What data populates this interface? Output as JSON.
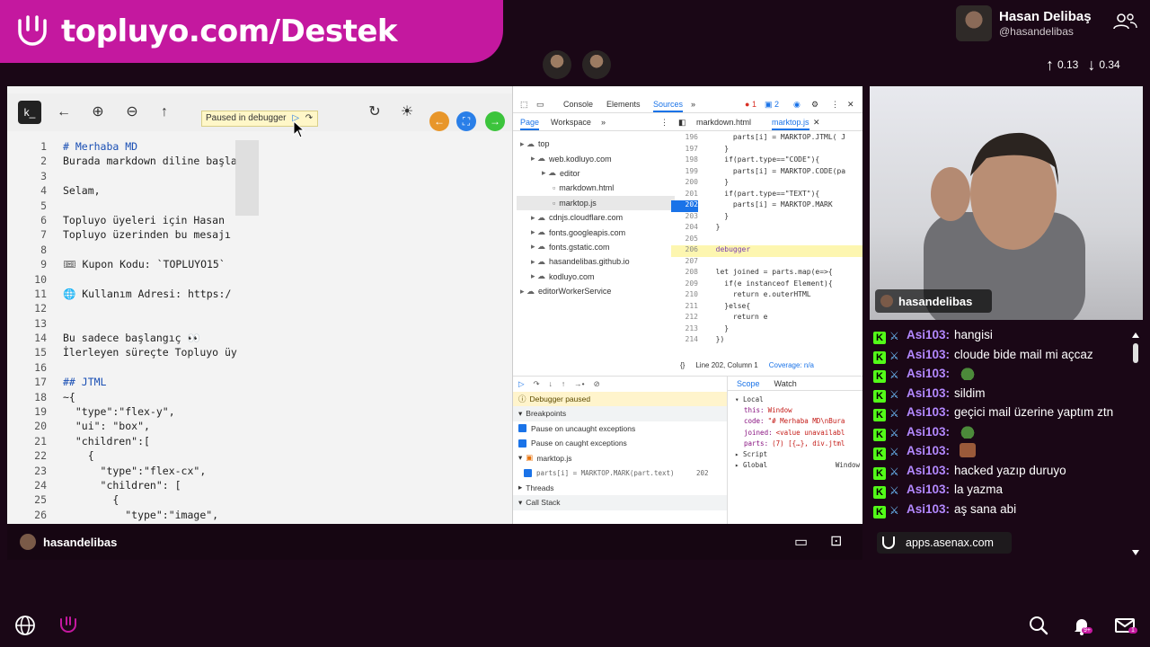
{
  "banner": {
    "text": "topluyo.com/Destek"
  },
  "streamer": {
    "name": "Hasan Delibaş",
    "handle": "@hasandelibas"
  },
  "votes": {
    "up": "0.13",
    "down": "0.34"
  },
  "browser": {
    "paused_label": "Paused in debugger"
  },
  "editor": {
    "lines": [
      {
        "n": "1",
        "t": "# Merhaba MD"
      },
      {
        "n": "2",
        "t": "Burada markdown diline başla"
      },
      {
        "n": "3",
        "t": ""
      },
      {
        "n": "4",
        "t": "Selam,"
      },
      {
        "n": "5",
        "t": ""
      },
      {
        "n": "6",
        "t": "Topluyo üyeleri için Hasan"
      },
      {
        "n": "7",
        "t": "Topluyo üzerinden bu mesajı"
      },
      {
        "n": "8",
        "t": ""
      },
      {
        "n": "9",
        "t": "🎟 Kupon Kodu: `TOPLUYO15`"
      },
      {
        "n": "10",
        "t": ""
      },
      {
        "n": "11",
        "t": "🌐 Kullanım Adresi: https:/"
      },
      {
        "n": "12",
        "t": ""
      },
      {
        "n": "13",
        "t": ""
      },
      {
        "n": "14",
        "t": "Bu sadece başlangıç 👀"
      },
      {
        "n": "15",
        "t": "İlerleyen süreçte Topluyo üy"
      },
      {
        "n": "16",
        "t": ""
      },
      {
        "n": "17",
        "t": "## JTML"
      },
      {
        "n": "18",
        "t": "~{"
      },
      {
        "n": "19",
        "t": "  \"type\":\"flex-y\","
      },
      {
        "n": "20",
        "t": "  \"ui\": \"box\","
      },
      {
        "n": "21",
        "t": "  \"children\":["
      },
      {
        "n": "22",
        "t": "    {"
      },
      {
        "n": "23",
        "t": "      \"type\":\"flex-cx\","
      },
      {
        "n": "24",
        "t": "      \"children\": ["
      },
      {
        "n": "25",
        "t": "        {"
      },
      {
        "n": "26",
        "t": "          \"type\":\"image\","
      }
    ]
  },
  "devtools": {
    "tabs": [
      "Console",
      "Elements",
      "Sources"
    ],
    "counts": {
      "errors": "1",
      "warnings": "2"
    },
    "sub_tabs": [
      "Page",
      "Workspace"
    ],
    "file_tabs": [
      "markdown.html",
      "marktop.js"
    ],
    "tree": [
      {
        "label": "top",
        "indent": 0
      },
      {
        "label": "web.kodluyo.com",
        "indent": 1
      },
      {
        "label": "editor",
        "indent": 2
      },
      {
        "label": "markdown.html",
        "indent": 3
      },
      {
        "label": "marktop.js",
        "indent": 3,
        "selected": true
      },
      {
        "label": "cdnjs.cloudflare.com",
        "indent": 1
      },
      {
        "label": "fonts.googleapis.com",
        "indent": 1
      },
      {
        "label": "fonts.gstatic.com",
        "indent": 1
      },
      {
        "label": "hasandelibas.github.io",
        "indent": 1
      },
      {
        "label": "kodluyo.com",
        "indent": 1
      },
      {
        "label": "editorWorkerService",
        "indent": 0
      }
    ],
    "source": [
      {
        "n": "196",
        "t": "      parts[i] = MARKTOP.JTML( J"
      },
      {
        "n": "197",
        "t": "    }"
      },
      {
        "n": "198",
        "t": "    if(part.type==\"CODE\"){"
      },
      {
        "n": "199",
        "t": "      parts[i] = MARKTOP.CODE(pa"
      },
      {
        "n": "200",
        "t": "    }"
      },
      {
        "n": "201",
        "t": "    if(part.type==\"TEXT\"){"
      },
      {
        "n": "202",
        "t": "      parts[i] = MARKTOP.MARK",
        "hl": true
      },
      {
        "n": "203",
        "t": "    }"
      },
      {
        "n": "204",
        "t": "  }"
      },
      {
        "n": "205",
        "t": ""
      },
      {
        "n": "206",
        "t": "  debugger",
        "dbg": true
      },
      {
        "n": "207",
        "t": ""
      },
      {
        "n": "208",
        "t": "  let joined = parts.map(e=>{"
      },
      {
        "n": "209",
        "t": "    if(e instanceof Element){"
      },
      {
        "n": "210",
        "t": "      return e.outerHTML"
      },
      {
        "n": "211",
        "t": "    }else{"
      },
      {
        "n": "212",
        "t": "      return e"
      },
      {
        "n": "213",
        "t": "    }"
      },
      {
        "n": "214",
        "t": "  })"
      }
    ],
    "status": {
      "line": "Line 202, Column 1",
      "coverage": "Coverage: n/a"
    },
    "debug": {
      "paused": "Debugger paused",
      "breakpoints": "Breakpoints",
      "uncaught": "Pause on uncaught exceptions",
      "caught": "Pause on caught exceptions",
      "file": "marktop.js",
      "bp_code": "parts[i] = MARKTOP.MARK(part.text)",
      "bp_line": "202",
      "threads": "Threads",
      "callstack": "Call Stack"
    },
    "scope": {
      "tabs": [
        "Scope",
        "Watch"
      ],
      "local": "Local",
      "rows": [
        {
          "k": "this:",
          "v": "Window"
        },
        {
          "k": "code:",
          "v": "\"# Merhaba MD\\nBura"
        },
        {
          "k": "joined:",
          "v": "<value unavailabl"
        },
        {
          "k": "parts:",
          "v": "(7) [{…}, div.jtml"
        }
      ],
      "script": "Script",
      "global": "Global",
      "global_val": "Window"
    }
  },
  "stream": {
    "name": "hasandelibas"
  },
  "webcam": {
    "label": "hasandelibas"
  },
  "chat": {
    "messages": [
      {
        "user": "Asi103:",
        "text": "hangisi"
      },
      {
        "user": "Asi103:",
        "text": "cloude bide mail mi açcaz"
      },
      {
        "user": "Asi103:",
        "text": "",
        "emote": "frog"
      },
      {
        "user": "Asi103:",
        "text": "sildim"
      },
      {
        "user": "Asi103:",
        "text": "geçici mail üzerine yaptım ztn"
      },
      {
        "user": "Asi103:",
        "text": "",
        "emote": "frog"
      },
      {
        "user": "Asi103:",
        "text": "",
        "emote": "face"
      },
      {
        "user": "Asi103:",
        "text": "hacked yazıp duruyo"
      },
      {
        "user": "Asi103:",
        "text": "la yazma"
      },
      {
        "user": "Asi103:",
        "text": "aş sana abi"
      }
    ],
    "overlay": "apps.asenax.com"
  },
  "footer": {
    "notif_badge": "9+",
    "mail_badge": "1"
  },
  "colors": {
    "brand": "#c4189f",
    "kick": "#53fc18",
    "chat_user": "#b388ff"
  }
}
